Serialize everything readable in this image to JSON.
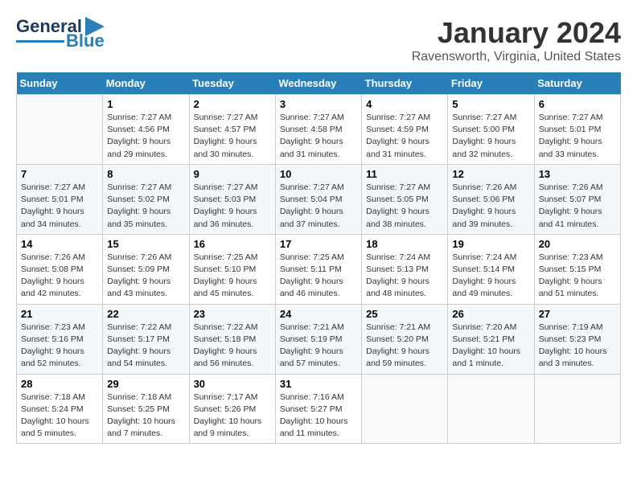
{
  "logo": {
    "part1": "General",
    "part2": "Blue"
  },
  "title": "January 2024",
  "subtitle": "Ravensworth, Virginia, United States",
  "weekdays": [
    "Sunday",
    "Monday",
    "Tuesday",
    "Wednesday",
    "Thursday",
    "Friday",
    "Saturday"
  ],
  "weeks": [
    [
      {
        "num": "",
        "sunrise": "",
        "sunset": "",
        "daylight": "",
        "empty": true
      },
      {
        "num": "1",
        "sunrise": "Sunrise: 7:27 AM",
        "sunset": "Sunset: 4:56 PM",
        "daylight": "Daylight: 9 hours and 29 minutes."
      },
      {
        "num": "2",
        "sunrise": "Sunrise: 7:27 AM",
        "sunset": "Sunset: 4:57 PM",
        "daylight": "Daylight: 9 hours and 30 minutes."
      },
      {
        "num": "3",
        "sunrise": "Sunrise: 7:27 AM",
        "sunset": "Sunset: 4:58 PM",
        "daylight": "Daylight: 9 hours and 31 minutes."
      },
      {
        "num": "4",
        "sunrise": "Sunrise: 7:27 AM",
        "sunset": "Sunset: 4:59 PM",
        "daylight": "Daylight: 9 hours and 31 minutes."
      },
      {
        "num": "5",
        "sunrise": "Sunrise: 7:27 AM",
        "sunset": "Sunset: 5:00 PM",
        "daylight": "Daylight: 9 hours and 32 minutes."
      },
      {
        "num": "6",
        "sunrise": "Sunrise: 7:27 AM",
        "sunset": "Sunset: 5:01 PM",
        "daylight": "Daylight: 9 hours and 33 minutes."
      }
    ],
    [
      {
        "num": "7",
        "sunrise": "Sunrise: 7:27 AM",
        "sunset": "Sunset: 5:01 PM",
        "daylight": "Daylight: 9 hours and 34 minutes."
      },
      {
        "num": "8",
        "sunrise": "Sunrise: 7:27 AM",
        "sunset": "Sunset: 5:02 PM",
        "daylight": "Daylight: 9 hours and 35 minutes."
      },
      {
        "num": "9",
        "sunrise": "Sunrise: 7:27 AM",
        "sunset": "Sunset: 5:03 PM",
        "daylight": "Daylight: 9 hours and 36 minutes."
      },
      {
        "num": "10",
        "sunrise": "Sunrise: 7:27 AM",
        "sunset": "Sunset: 5:04 PM",
        "daylight": "Daylight: 9 hours and 37 minutes."
      },
      {
        "num": "11",
        "sunrise": "Sunrise: 7:27 AM",
        "sunset": "Sunset: 5:05 PM",
        "daylight": "Daylight: 9 hours and 38 minutes."
      },
      {
        "num": "12",
        "sunrise": "Sunrise: 7:26 AM",
        "sunset": "Sunset: 5:06 PM",
        "daylight": "Daylight: 9 hours and 39 minutes."
      },
      {
        "num": "13",
        "sunrise": "Sunrise: 7:26 AM",
        "sunset": "Sunset: 5:07 PM",
        "daylight": "Daylight: 9 hours and 41 minutes."
      }
    ],
    [
      {
        "num": "14",
        "sunrise": "Sunrise: 7:26 AM",
        "sunset": "Sunset: 5:08 PM",
        "daylight": "Daylight: 9 hours and 42 minutes."
      },
      {
        "num": "15",
        "sunrise": "Sunrise: 7:26 AM",
        "sunset": "Sunset: 5:09 PM",
        "daylight": "Daylight: 9 hours and 43 minutes."
      },
      {
        "num": "16",
        "sunrise": "Sunrise: 7:25 AM",
        "sunset": "Sunset: 5:10 PM",
        "daylight": "Daylight: 9 hours and 45 minutes."
      },
      {
        "num": "17",
        "sunrise": "Sunrise: 7:25 AM",
        "sunset": "Sunset: 5:11 PM",
        "daylight": "Daylight: 9 hours and 46 minutes."
      },
      {
        "num": "18",
        "sunrise": "Sunrise: 7:24 AM",
        "sunset": "Sunset: 5:13 PM",
        "daylight": "Daylight: 9 hours and 48 minutes."
      },
      {
        "num": "19",
        "sunrise": "Sunrise: 7:24 AM",
        "sunset": "Sunset: 5:14 PM",
        "daylight": "Daylight: 9 hours and 49 minutes."
      },
      {
        "num": "20",
        "sunrise": "Sunrise: 7:23 AM",
        "sunset": "Sunset: 5:15 PM",
        "daylight": "Daylight: 9 hours and 51 minutes."
      }
    ],
    [
      {
        "num": "21",
        "sunrise": "Sunrise: 7:23 AM",
        "sunset": "Sunset: 5:16 PM",
        "daylight": "Daylight: 9 hours and 52 minutes."
      },
      {
        "num": "22",
        "sunrise": "Sunrise: 7:22 AM",
        "sunset": "Sunset: 5:17 PM",
        "daylight": "Daylight: 9 hours and 54 minutes."
      },
      {
        "num": "23",
        "sunrise": "Sunrise: 7:22 AM",
        "sunset": "Sunset: 5:18 PM",
        "daylight": "Daylight: 9 hours and 56 minutes."
      },
      {
        "num": "24",
        "sunrise": "Sunrise: 7:21 AM",
        "sunset": "Sunset: 5:19 PM",
        "daylight": "Daylight: 9 hours and 57 minutes."
      },
      {
        "num": "25",
        "sunrise": "Sunrise: 7:21 AM",
        "sunset": "Sunset: 5:20 PM",
        "daylight": "Daylight: 9 hours and 59 minutes."
      },
      {
        "num": "26",
        "sunrise": "Sunrise: 7:20 AM",
        "sunset": "Sunset: 5:21 PM",
        "daylight": "Daylight: 10 hours and 1 minute."
      },
      {
        "num": "27",
        "sunrise": "Sunrise: 7:19 AM",
        "sunset": "Sunset: 5:23 PM",
        "daylight": "Daylight: 10 hours and 3 minutes."
      }
    ],
    [
      {
        "num": "28",
        "sunrise": "Sunrise: 7:18 AM",
        "sunset": "Sunset: 5:24 PM",
        "daylight": "Daylight: 10 hours and 5 minutes."
      },
      {
        "num": "29",
        "sunrise": "Sunrise: 7:18 AM",
        "sunset": "Sunset: 5:25 PM",
        "daylight": "Daylight: 10 hours and 7 minutes."
      },
      {
        "num": "30",
        "sunrise": "Sunrise: 7:17 AM",
        "sunset": "Sunset: 5:26 PM",
        "daylight": "Daylight: 10 hours and 9 minutes."
      },
      {
        "num": "31",
        "sunrise": "Sunrise: 7:16 AM",
        "sunset": "Sunset: 5:27 PM",
        "daylight": "Daylight: 10 hours and 11 minutes."
      },
      {
        "num": "",
        "sunrise": "",
        "sunset": "",
        "daylight": "",
        "empty": true
      },
      {
        "num": "",
        "sunrise": "",
        "sunset": "",
        "daylight": "",
        "empty": true
      },
      {
        "num": "",
        "sunrise": "",
        "sunset": "",
        "daylight": "",
        "empty": true
      }
    ]
  ]
}
